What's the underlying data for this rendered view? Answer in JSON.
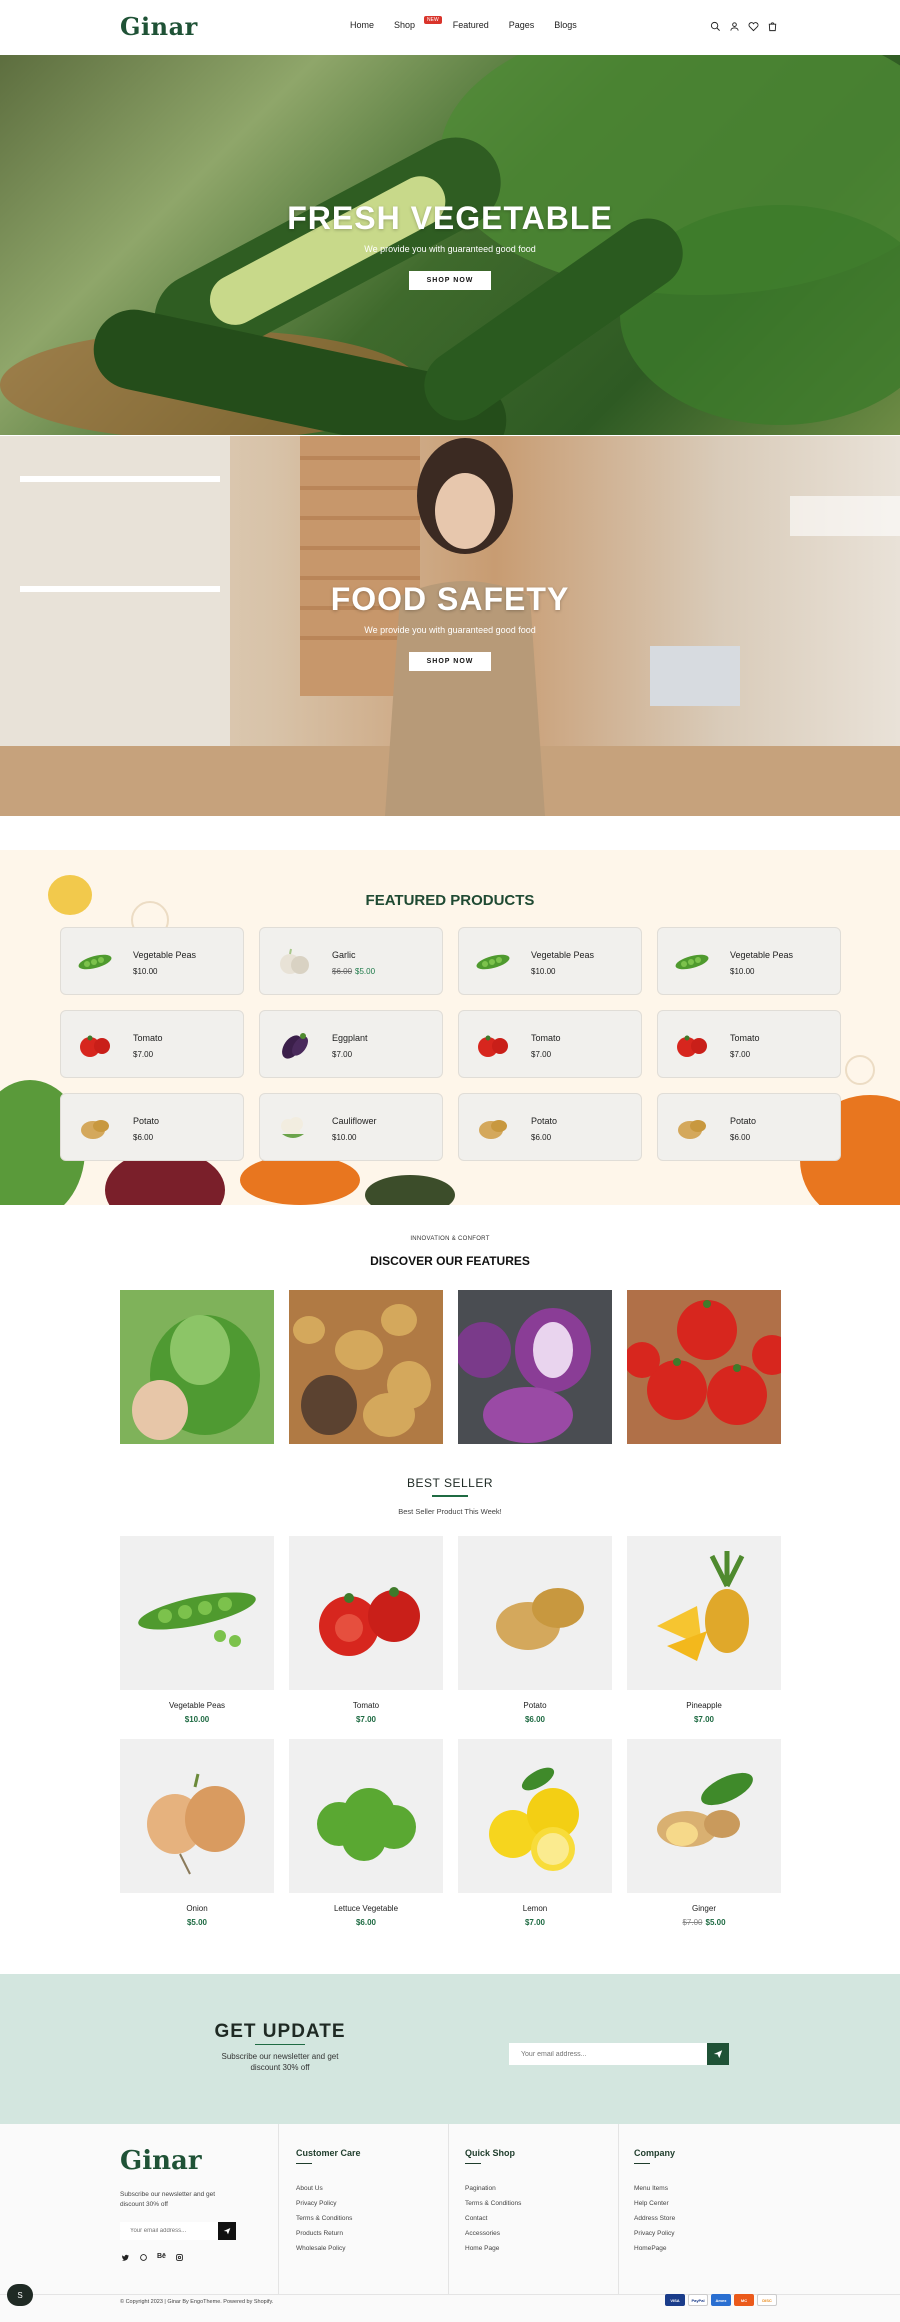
{
  "header": {
    "logo": "Ginar",
    "nav": [
      "Home",
      "Shop",
      "Featured",
      "Pages",
      "Blogs"
    ],
    "new_badge": "NEW"
  },
  "hero1": {
    "title": "FRESH VEGETABLE",
    "subtitle": "We provide you with guaranteed good food",
    "button": "SHOP NOW"
  },
  "hero2": {
    "title": "FOOD SAFETY",
    "subtitle": "We provide you with guaranteed good food",
    "button": "SHOP NOW"
  },
  "featured": {
    "title": "FEATURED PRODUCTS",
    "items": [
      {
        "name": "Vegetable Peas",
        "price": "$10.00",
        "icon": "peas-icon"
      },
      {
        "name": "Garlic",
        "old_price": "$6.00",
        "price": "$5.00",
        "icon": "garlic-icon"
      },
      {
        "name": "Vegetable Peas",
        "price": "$10.00",
        "icon": "peas-icon"
      },
      {
        "name": "Vegetable Peas",
        "price": "$10.00",
        "icon": "peas-icon"
      },
      {
        "name": "Tomato",
        "price": "$7.00",
        "icon": "tomato-icon"
      },
      {
        "name": "Eggplant",
        "price": "$7.00",
        "icon": "eggplant-icon"
      },
      {
        "name": "Tomato",
        "price": "$7.00",
        "icon": "tomato-icon"
      },
      {
        "name": "Tomato",
        "price": "$7.00",
        "icon": "tomato-icon"
      },
      {
        "name": "Potato",
        "price": "$6.00",
        "icon": "potato-icon"
      },
      {
        "name": "Cauliflower",
        "price": "$10.00",
        "icon": "cauliflower-icon"
      },
      {
        "name": "Potato",
        "price": "$6.00",
        "icon": "potato-icon"
      },
      {
        "name": "Potato",
        "price": "$6.00",
        "icon": "potato-icon"
      }
    ]
  },
  "features": {
    "eyebrow": "INNOVATION & CONFORT",
    "title": "DISCOVER OUR FEATURES"
  },
  "best_seller": {
    "title": "BEST SELLER",
    "subtitle": "Best Seller Product This Week!",
    "items": [
      {
        "name": "Vegetable Peas",
        "price": "$10.00"
      },
      {
        "name": "Tomato",
        "price": "$7.00"
      },
      {
        "name": "Potato",
        "price": "$6.00"
      },
      {
        "name": "Pineapple",
        "price": "$7.00"
      },
      {
        "name": "Onion",
        "price": "$5.00"
      },
      {
        "name": "Lettuce Vegetable",
        "price": "$6.00"
      },
      {
        "name": "Lemon",
        "price": "$7.00"
      },
      {
        "name": "Ginger",
        "old_price": "$7.00",
        "price": "$5.00"
      }
    ]
  },
  "newsletter": {
    "title": "GET UPDATE",
    "text_line1": "Subscribe our newsletter and get",
    "text_line2": "discount 30% off",
    "placeholder": "Your email address..."
  },
  "footer": {
    "logo": "Ginar",
    "text_line1": "Subscribe our newsletter and get",
    "text_line2": "discount 30% off",
    "placeholder": "Your email address...",
    "col1": {
      "title": "Customer Care",
      "links": [
        "About Us",
        "Privacy Policy",
        "Terms & Conditions",
        "Products Return",
        "Wholesale Policy"
      ]
    },
    "col2": {
      "title": "Quick Shop",
      "links": [
        "Pagination",
        "Terms & Conditions",
        "Contact",
        "Accessories",
        "Home Page"
      ]
    },
    "col3": {
      "title": "Company",
      "links": [
        "Menu Items",
        "Help Center",
        "Address Store",
        "Privacy Policy",
        "HomePage"
      ]
    },
    "copyright": "© Copyright 2023 | Ginar By EngoTheme. Powered by Shopify.",
    "payments": [
      "VISA",
      "PayPal",
      "Amex",
      "MC",
      "DISC"
    ]
  },
  "colors": {
    "brand": "#1f5236",
    "accent_green": "#1f6b43",
    "newsletter_bg": "#d3e6df",
    "featured_bg": "#fef6ea"
  }
}
